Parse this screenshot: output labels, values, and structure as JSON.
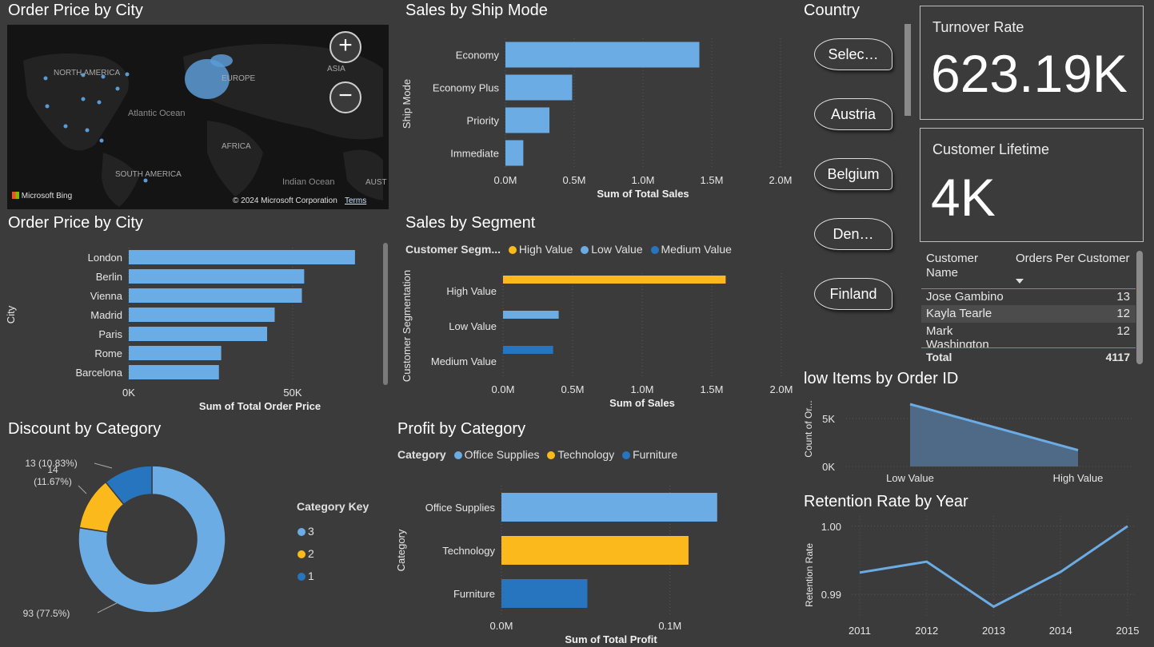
{
  "colors": {
    "bg": "#3b3b3b",
    "blue_light": "#6cace4",
    "yellow": "#fbb91b",
    "blue_dark": "#2775bf"
  },
  "map": {
    "title": "Order Price by City",
    "labels": {
      "na": "NORTH AMERICA",
      "europe": "EUROPE",
      "asia": "ASIA",
      "atlantic": "Atlantic Ocean",
      "africa": "AFRICA",
      "sa": "SOUTH AMERICA",
      "indian": "Indian Ocean",
      "aust": "AUST"
    },
    "bing": "Microsoft Bing",
    "copyright": "© 2024 Microsoft Corporation",
    "terms": "Terms",
    "zoom_in": "+",
    "zoom_out": "−"
  },
  "city_chart": {
    "title": "Order Price by City",
    "chart_data": {
      "type": "bar",
      "orientation": "horizontal",
      "categories": [
        "London",
        "Berlin",
        "Vienna",
        "Madrid",
        "Paris",
        "Rome",
        "Barcelona"
      ],
      "values": [
        69000,
        53500,
        52800,
        44500,
        42200,
        28200,
        27500
      ],
      "xlabel": "Sum of Total Order Price",
      "ylabel": "City",
      "xlim": [
        0,
        80000
      ],
      "xticks": [
        "0K",
        "50K"
      ],
      "xtick_values": [
        0,
        50000
      ]
    }
  },
  "ship_chart": {
    "title": "Sales by Ship Mode",
    "chart_data": {
      "type": "bar",
      "orientation": "horizontal",
      "categories": [
        "Economy",
        "Economy Plus",
        "Priority",
        "Immediate"
      ],
      "values": [
        1410000,
        485000,
        320000,
        130000
      ],
      "xlabel": "Sum of Total Sales",
      "ylabel": "Ship Mode",
      "xlim": [
        0,
        2000000
      ],
      "xticks": [
        "0.0M",
        "0.5M",
        "1.0M",
        "1.5M",
        "2.0M"
      ],
      "xtick_values": [
        0,
        500000,
        1000000,
        1500000,
        2000000
      ]
    }
  },
  "segment_chart": {
    "title": "Sales by Segment",
    "legend_title": "Customer Segm...",
    "chart_data": {
      "type": "bar",
      "orientation": "horizontal",
      "categories": [
        "High Value",
        "Low Value",
        "Medium Value"
      ],
      "values": [
        1600000,
        400000,
        360000
      ],
      "series_colors": [
        "#fbb91b",
        "#6cace4",
        "#2775bf"
      ],
      "legend": [
        "High Value",
        "Low Value",
        "Medium Value"
      ],
      "xlabel": "Sum of Sales",
      "ylabel": "Customer Segmentation",
      "xlim": [
        0,
        2000000
      ],
      "xticks": [
        "0.0M",
        "0.5M",
        "1.0M",
        "1.5M",
        "2.0M"
      ],
      "xtick_values": [
        0,
        500000,
        1000000,
        1500000,
        2000000
      ]
    }
  },
  "discount_chart": {
    "title": "Discount by Category",
    "legend_title": "Category Key",
    "chart_data": {
      "type": "pie",
      "donut": true,
      "categories": [
        "3",
        "2",
        "1"
      ],
      "values": [
        93,
        14,
        13
      ],
      "labels": [
        "93 (77.5%)",
        "14\n(11.67%)",
        "13 (10.83%)"
      ],
      "colors": [
        "#6cace4",
        "#fbb91b",
        "#2775bf"
      ]
    }
  },
  "profit_chart": {
    "title": "Profit by Category",
    "legend_title": "Category",
    "chart_data": {
      "type": "bar",
      "orientation": "horizontal",
      "categories": [
        "Office Supplies",
        "Technology",
        "Furniture"
      ],
      "values": [
        128000,
        111000,
        51000
      ],
      "series_colors": [
        "#6cace4",
        "#fbb91b",
        "#2775bf"
      ],
      "legend": [
        "Office Supplies",
        "Technology",
        "Furniture"
      ],
      "xlabel": "Sum of Total Profit",
      "ylabel": "Category",
      "xlim": [
        0,
        130000
      ],
      "xticks": [
        "0.0M",
        "0.1M"
      ],
      "xtick_values": [
        0,
        100000
      ]
    }
  },
  "country_slicer": {
    "title": "Country",
    "items": [
      "Selec…",
      "Austria",
      "Belgium",
      "Den…",
      "Finland"
    ]
  },
  "cards": [
    {
      "title": "Turnover Rate",
      "value": "623.19K"
    },
    {
      "title": "Customer Lifetime",
      "value": "4K"
    }
  ],
  "customer_table": {
    "headers": [
      "Customer\nName",
      "Orders Per Customer"
    ],
    "rows": [
      [
        "Jose Gambino",
        "13"
      ],
      [
        "Kayla Tearle",
        "12"
      ],
      [
        "Mark\nWashington",
        "12"
      ]
    ],
    "total_label": "Total",
    "total_value": "4117"
  },
  "items_chart": {
    "title": "low Items by Order ID",
    "chart_data": {
      "type": "area",
      "categories": [
        "Low Value",
        "High Value"
      ],
      "values": [
        6500,
        1700
      ],
      "ylabel": "Count of Or...",
      "ylim": [
        0,
        7000
      ],
      "yticks": [
        "0K",
        "5K"
      ],
      "ytick_values": [
        0,
        5000
      ]
    }
  },
  "retention_chart": {
    "title": "Retention Rate by Year",
    "chart_data": {
      "type": "line",
      "x": [
        "2011",
        "2012",
        "2013",
        "2014",
        "2015"
      ],
      "values": [
        0.9932,
        0.9948,
        0.9882,
        0.9933,
        1.0
      ],
      "ylabel": "Retention Rate",
      "ylim": [
        0.9865,
        1.0015
      ],
      "yticks": [
        "0.99",
        "1.00"
      ],
      "ytick_values": [
        0.99,
        1.0
      ]
    }
  }
}
